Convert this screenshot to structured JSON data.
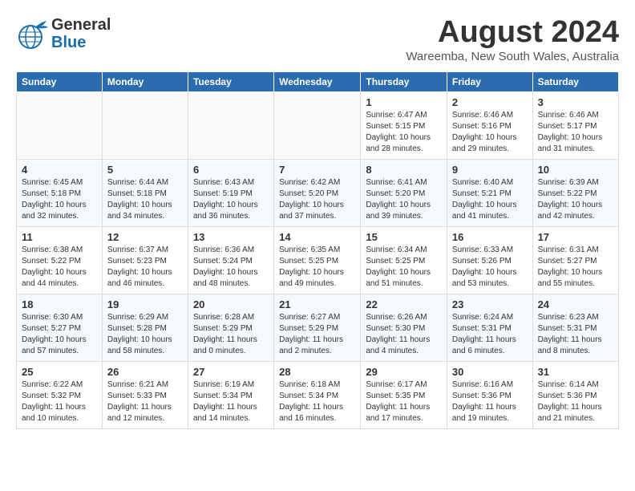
{
  "header": {
    "logo_line1": "General",
    "logo_line2": "Blue",
    "month_year": "August 2024",
    "location": "Wareemba, New South Wales, Australia"
  },
  "weekdays": [
    "Sunday",
    "Monday",
    "Tuesday",
    "Wednesday",
    "Thursday",
    "Friday",
    "Saturday"
  ],
  "weeks": [
    [
      {
        "day": "",
        "info": ""
      },
      {
        "day": "",
        "info": ""
      },
      {
        "day": "",
        "info": ""
      },
      {
        "day": "",
        "info": ""
      },
      {
        "day": "1",
        "info": "Sunrise: 6:47 AM\nSunset: 5:15 PM\nDaylight: 10 hours\nand 28 minutes."
      },
      {
        "day": "2",
        "info": "Sunrise: 6:46 AM\nSunset: 5:16 PM\nDaylight: 10 hours\nand 29 minutes."
      },
      {
        "day": "3",
        "info": "Sunrise: 6:46 AM\nSunset: 5:17 PM\nDaylight: 10 hours\nand 31 minutes."
      }
    ],
    [
      {
        "day": "4",
        "info": "Sunrise: 6:45 AM\nSunset: 5:18 PM\nDaylight: 10 hours\nand 32 minutes."
      },
      {
        "day": "5",
        "info": "Sunrise: 6:44 AM\nSunset: 5:18 PM\nDaylight: 10 hours\nand 34 minutes."
      },
      {
        "day": "6",
        "info": "Sunrise: 6:43 AM\nSunset: 5:19 PM\nDaylight: 10 hours\nand 36 minutes."
      },
      {
        "day": "7",
        "info": "Sunrise: 6:42 AM\nSunset: 5:20 PM\nDaylight: 10 hours\nand 37 minutes."
      },
      {
        "day": "8",
        "info": "Sunrise: 6:41 AM\nSunset: 5:20 PM\nDaylight: 10 hours\nand 39 minutes."
      },
      {
        "day": "9",
        "info": "Sunrise: 6:40 AM\nSunset: 5:21 PM\nDaylight: 10 hours\nand 41 minutes."
      },
      {
        "day": "10",
        "info": "Sunrise: 6:39 AM\nSunset: 5:22 PM\nDaylight: 10 hours\nand 42 minutes."
      }
    ],
    [
      {
        "day": "11",
        "info": "Sunrise: 6:38 AM\nSunset: 5:22 PM\nDaylight: 10 hours\nand 44 minutes."
      },
      {
        "day": "12",
        "info": "Sunrise: 6:37 AM\nSunset: 5:23 PM\nDaylight: 10 hours\nand 46 minutes."
      },
      {
        "day": "13",
        "info": "Sunrise: 6:36 AM\nSunset: 5:24 PM\nDaylight: 10 hours\nand 48 minutes."
      },
      {
        "day": "14",
        "info": "Sunrise: 6:35 AM\nSunset: 5:25 PM\nDaylight: 10 hours\nand 49 minutes."
      },
      {
        "day": "15",
        "info": "Sunrise: 6:34 AM\nSunset: 5:25 PM\nDaylight: 10 hours\nand 51 minutes."
      },
      {
        "day": "16",
        "info": "Sunrise: 6:33 AM\nSunset: 5:26 PM\nDaylight: 10 hours\nand 53 minutes."
      },
      {
        "day": "17",
        "info": "Sunrise: 6:31 AM\nSunset: 5:27 PM\nDaylight: 10 hours\nand 55 minutes."
      }
    ],
    [
      {
        "day": "18",
        "info": "Sunrise: 6:30 AM\nSunset: 5:27 PM\nDaylight: 10 hours\nand 57 minutes."
      },
      {
        "day": "19",
        "info": "Sunrise: 6:29 AM\nSunset: 5:28 PM\nDaylight: 10 hours\nand 58 minutes."
      },
      {
        "day": "20",
        "info": "Sunrise: 6:28 AM\nSunset: 5:29 PM\nDaylight: 11 hours\nand 0 minutes."
      },
      {
        "day": "21",
        "info": "Sunrise: 6:27 AM\nSunset: 5:29 PM\nDaylight: 11 hours\nand 2 minutes."
      },
      {
        "day": "22",
        "info": "Sunrise: 6:26 AM\nSunset: 5:30 PM\nDaylight: 11 hours\nand 4 minutes."
      },
      {
        "day": "23",
        "info": "Sunrise: 6:24 AM\nSunset: 5:31 PM\nDaylight: 11 hours\nand 6 minutes."
      },
      {
        "day": "24",
        "info": "Sunrise: 6:23 AM\nSunset: 5:31 PM\nDaylight: 11 hours\nand 8 minutes."
      }
    ],
    [
      {
        "day": "25",
        "info": "Sunrise: 6:22 AM\nSunset: 5:32 PM\nDaylight: 11 hours\nand 10 minutes."
      },
      {
        "day": "26",
        "info": "Sunrise: 6:21 AM\nSunset: 5:33 PM\nDaylight: 11 hours\nand 12 minutes."
      },
      {
        "day": "27",
        "info": "Sunrise: 6:19 AM\nSunset: 5:34 PM\nDaylight: 11 hours\nand 14 minutes."
      },
      {
        "day": "28",
        "info": "Sunrise: 6:18 AM\nSunset: 5:34 PM\nDaylight: 11 hours\nand 16 minutes."
      },
      {
        "day": "29",
        "info": "Sunrise: 6:17 AM\nSunset: 5:35 PM\nDaylight: 11 hours\nand 17 minutes."
      },
      {
        "day": "30",
        "info": "Sunrise: 6:16 AM\nSunset: 5:36 PM\nDaylight: 11 hours\nand 19 minutes."
      },
      {
        "day": "31",
        "info": "Sunrise: 6:14 AM\nSunset: 5:36 PM\nDaylight: 11 hours\nand 21 minutes."
      }
    ]
  ]
}
